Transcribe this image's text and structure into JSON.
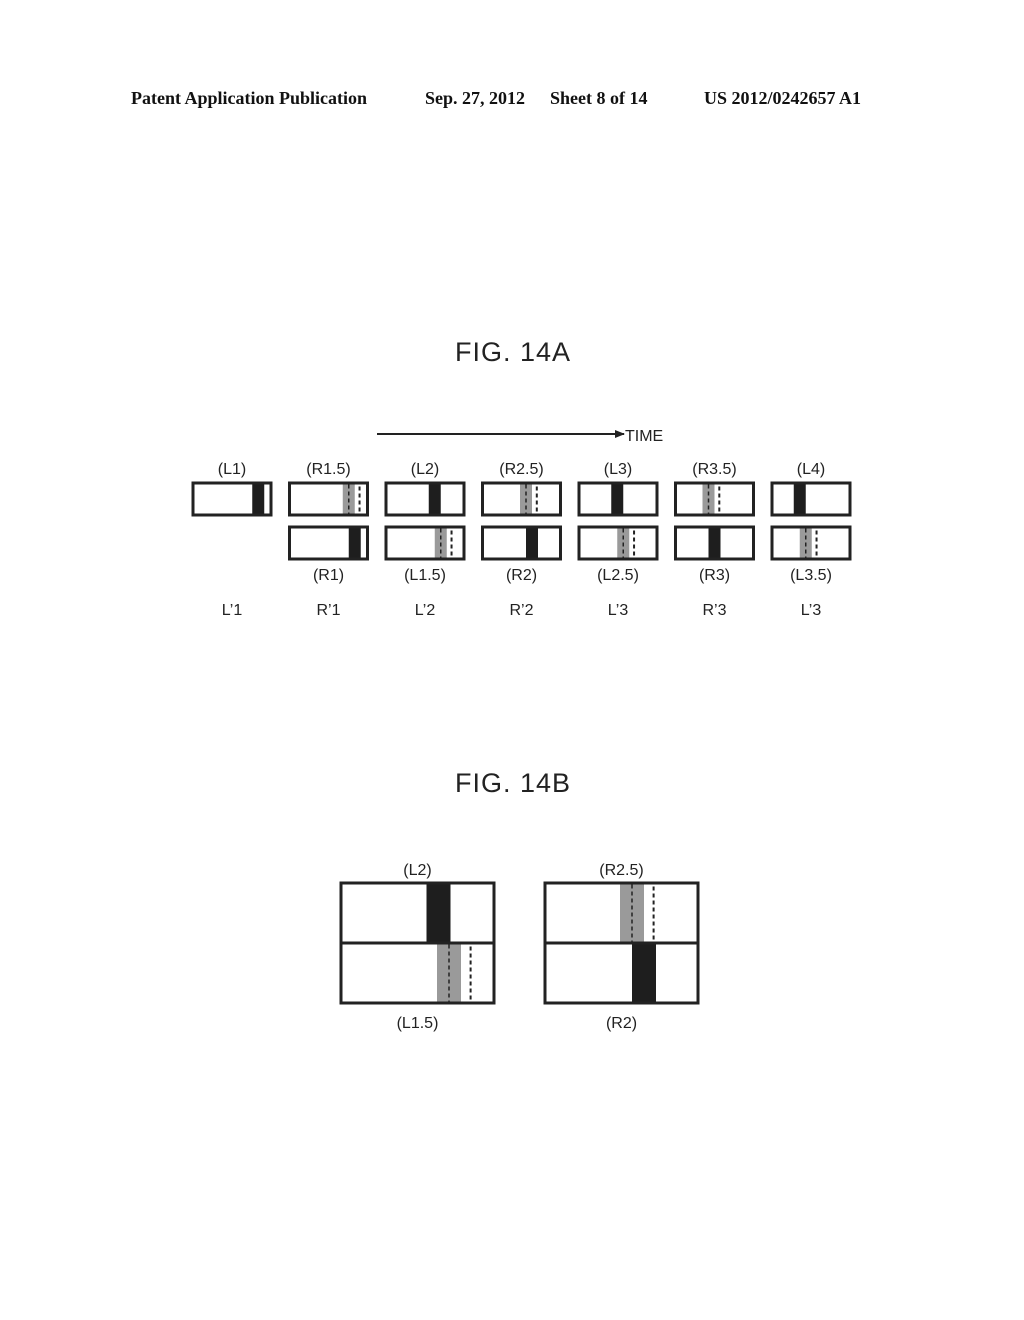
{
  "header": {
    "left": "Patent Application Publication",
    "date": "Sep. 27, 2012",
    "sheet": "Sheet 8 of 14",
    "number": "US 2012/0242657 A1"
  },
  "fig14a": {
    "title": "FIG. 14A",
    "time_label": "TIME",
    "columns": [
      {
        "top_label": "(L1)",
        "top": {
          "bar": "black",
          "pos": 0.77
        },
        "bottom": null,
        "bottom_label": "",
        "output_label": "L’1"
      },
      {
        "top_label": "(R1.5)",
        "top": {
          "bar": "gray",
          "pos": 0.69
        },
        "bottom": {
          "bar": "black",
          "pos": 0.77
        },
        "bottom_label": "(R1)",
        "output_label": "R’1"
      },
      {
        "top_label": "(L2)",
        "top": {
          "bar": "black",
          "pos": 0.55
        },
        "bottom": {
          "bar": "gray",
          "pos": 0.63
        },
        "bottom_label": "(L1.5)",
        "output_label": "L’2"
      },
      {
        "top_label": "(R2.5)",
        "top": {
          "bar": "gray",
          "pos": 0.48
        },
        "bottom": {
          "bar": "black",
          "pos": 0.56
        },
        "bottom_label": "(R2)",
        "output_label": "R’2"
      },
      {
        "top_label": "(L3)",
        "top": {
          "bar": "black",
          "pos": 0.41
        },
        "bottom": {
          "bar": "gray",
          "pos": 0.49
        },
        "bottom_label": "(L2.5)",
        "output_label": "L’3"
      },
      {
        "top_label": "(R3.5)",
        "top": {
          "bar": "gray",
          "pos": 0.34
        },
        "bottom": {
          "bar": "black",
          "pos": 0.42
        },
        "bottom_label": "(R3)",
        "output_label": "R’3"
      },
      {
        "top_label": "(L4)",
        "top": {
          "bar": "black",
          "pos": 0.27
        },
        "bottom": {
          "bar": "gray",
          "pos": 0.35
        },
        "bottom_label": "(L3.5)",
        "output_label": "L’3"
      }
    ]
  },
  "fig14b": {
    "title": "FIG. 14B",
    "panels": [
      {
        "top_label": "(L2)",
        "top": {
          "bar": "black",
          "pos": 0.56
        },
        "bottom": {
          "bar": "gray",
          "pos": 0.63
        },
        "bottom_label": "(L1.5)"
      },
      {
        "top_label": "(R2.5)",
        "top": {
          "bar": "gray",
          "pos": 0.49
        },
        "bottom": {
          "bar": "black",
          "pos": 0.57
        },
        "bottom_label": "(R2)"
      }
    ]
  },
  "colors": {
    "line": "#222222",
    "black_bar": "#1e1e1e",
    "gray_bar": "#9a9a9a"
  }
}
